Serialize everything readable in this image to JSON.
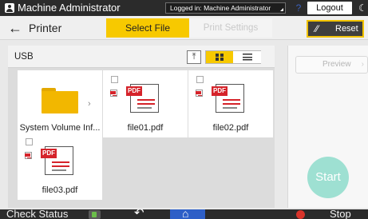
{
  "status_bar": {
    "user_name": "Machine Administrator",
    "login_text": "Logged in: Machine Administrator",
    "help_icon": "?",
    "logout_label": "Logout",
    "moon_icon": "☾"
  },
  "header": {
    "back_icon": "←",
    "app_title": "Printer",
    "tabs": [
      {
        "label": "Select File",
        "active": true
      },
      {
        "label": "Print Settings",
        "active": false
      }
    ],
    "reset_label": "Reset",
    "reset_icon": "eraser-icon"
  },
  "browser": {
    "location": "USB",
    "up_icon": "⤒",
    "view_mode": "grid"
  },
  "files": [
    {
      "name": "System Volume Inf...",
      "type": "folder"
    },
    {
      "name": "file01.pdf",
      "type": "pdf"
    },
    {
      "name": "file02.pdf",
      "type": "pdf"
    },
    {
      "name": "file03.pdf",
      "type": "pdf"
    }
  ],
  "pdf_tag": "PDF",
  "side_panel": {
    "preview_label": "Preview",
    "start_label": "Start"
  },
  "bottom_bar": {
    "check_status_label": "Check Status",
    "stop_label": "Stop",
    "return_icon": "↶",
    "home_icon": "⌂"
  },
  "colors": {
    "accent": "#f7c900",
    "start": "#9ee0d2",
    "home": "#2e5fc7",
    "stop": "#d8342b",
    "pdf": "#d5232a"
  }
}
